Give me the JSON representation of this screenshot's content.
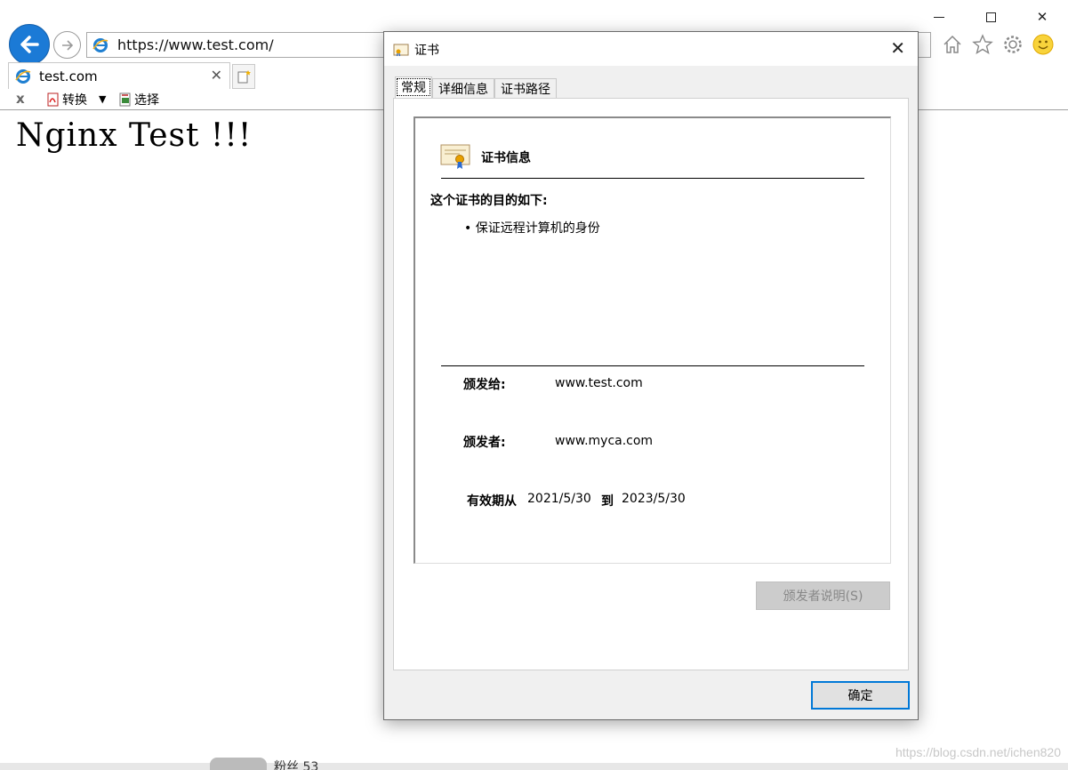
{
  "browser": {
    "address": "https://www.test.com/",
    "tab_title": "test.com",
    "cmdbar": {
      "close_mark": "x",
      "convert_label": "转换",
      "select_label": "选择"
    },
    "page_heading": "Nginx Test !!!",
    "bottom_fans": "粉丝 53",
    "watermark": "https://blog.csdn.net/ichen820"
  },
  "dialog": {
    "title": "证书",
    "tabs": [
      "常规",
      "详细信息",
      "证书路径"
    ],
    "active_tab": 0,
    "info": {
      "header": "证书信息",
      "purpose_title": "这个证书的目的如下:",
      "purposes": [
        "• 保证远程计算机的身份"
      ],
      "issued_to_label": "颁发给:",
      "issued_to": "www.test.com",
      "issued_by_label": "颁发者:",
      "issued_by": "www.myca.com",
      "valid_from_label": "有效期从",
      "valid_from": "2021/5/30",
      "valid_to_label": "到",
      "valid_to": "2023/5/30"
    },
    "issuer_statement_button": "颁发者说明(S)",
    "ok_button": "确定"
  }
}
